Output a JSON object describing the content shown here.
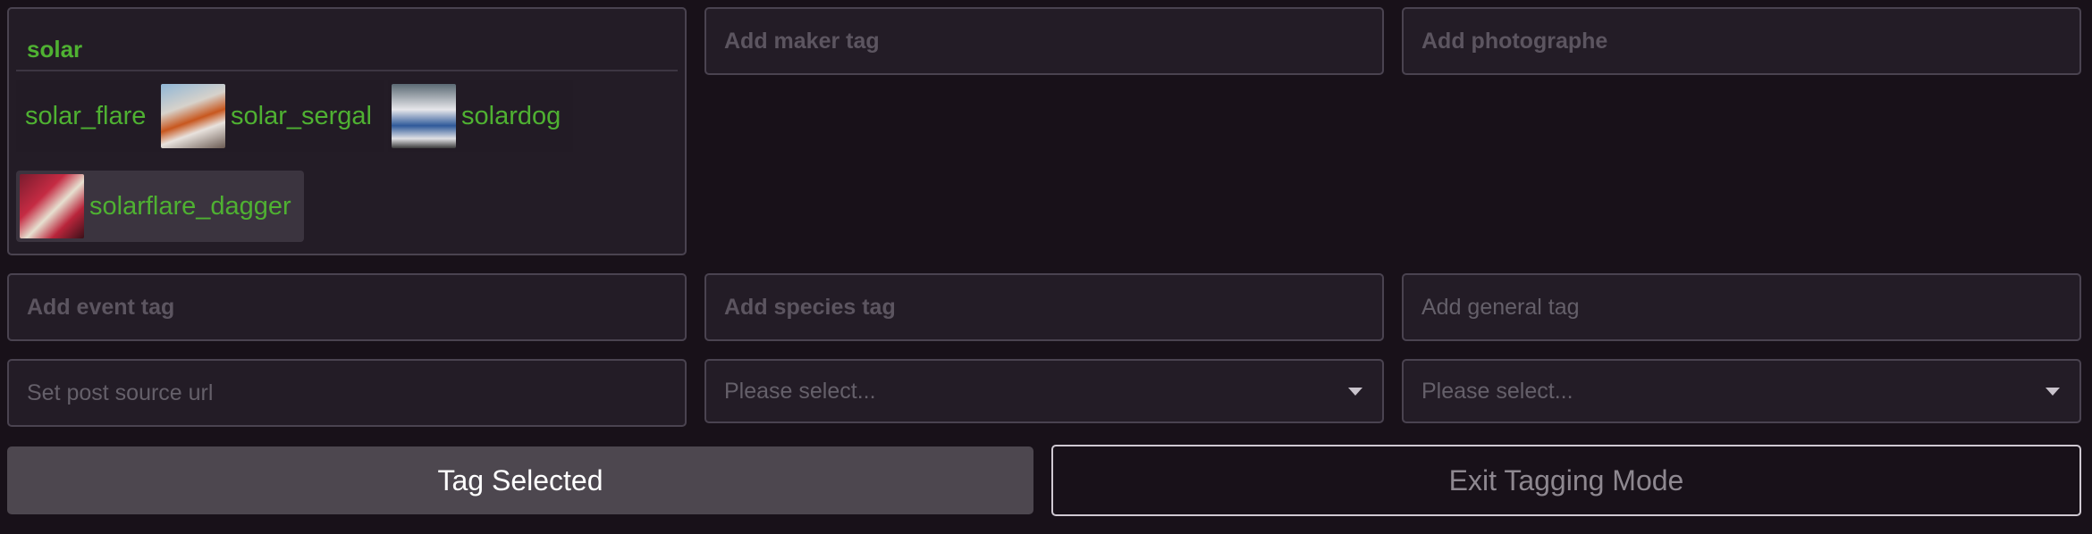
{
  "maker_search": {
    "value": "solar",
    "suggestions": [
      {
        "label": "solar_flare",
        "thumbnail": "none"
      },
      {
        "label": "solar_sergal",
        "thumbnail": "costume-photo"
      },
      {
        "label": "solardog",
        "thumbnail": "costume-photo"
      },
      {
        "label": "solarflare_dagger",
        "thumbnail": "costume-photo"
      }
    ]
  },
  "inputs": {
    "maker_placeholder": "Add maker tag",
    "photographer_placeholder": "Add photographe",
    "event_placeholder": "Add event tag",
    "species_placeholder": "Add species tag",
    "general_placeholder": "Add general tag",
    "source_placeholder": "Set post source url"
  },
  "selects": {
    "first_placeholder": "Please select...",
    "second_placeholder": "Please select..."
  },
  "buttons": {
    "tag_selected": "Tag Selected",
    "exit_tagging": "Exit Tagging Mode"
  },
  "colors": {
    "background": "#181119",
    "panel": "#231c26",
    "accent_green": "#4fb132"
  }
}
